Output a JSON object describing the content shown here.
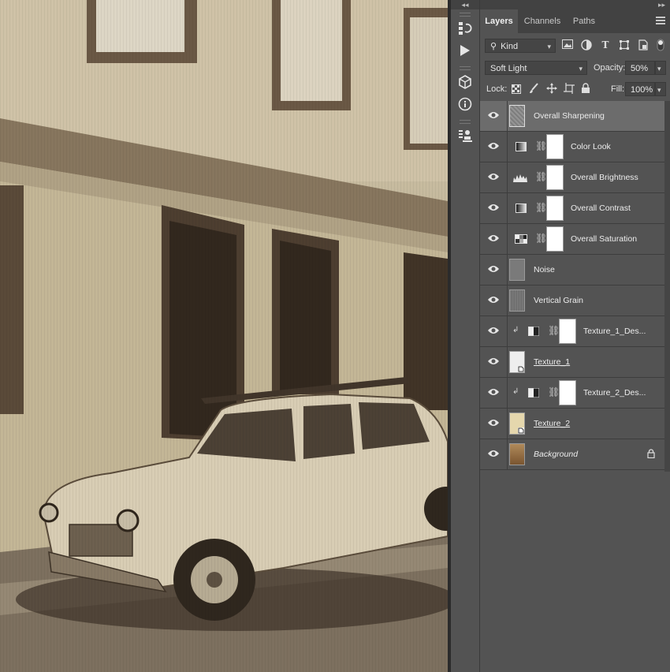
{
  "tabs": [
    {
      "label": "Layers",
      "active": true
    },
    {
      "label": "Channels",
      "active": false
    },
    {
      "label": "Paths",
      "active": false
    }
  ],
  "filter": {
    "kind_label": "Kind"
  },
  "blend": {
    "mode": "Soft Light",
    "opacity_label": "Opacity:",
    "opacity_value": "50%"
  },
  "lock": {
    "label": "Lock:",
    "fill_label": "Fill:",
    "fill_value": "100%"
  },
  "layers": [
    {
      "name": "Overall Sharpening",
      "selected": true
    },
    {
      "name": "Color Look"
    },
    {
      "name": "Overall Brightness"
    },
    {
      "name": "Overall Contrast"
    },
    {
      "name": "Overall Saturation"
    },
    {
      "name": "Noise"
    },
    {
      "name": "Vertical Grain"
    },
    {
      "name": "Texture_1_Des..."
    },
    {
      "name": "Texture_1"
    },
    {
      "name": "Texture_2_Des..."
    },
    {
      "name": "Texture_2"
    },
    {
      "name": "Background"
    }
  ],
  "colors": {
    "panel": "#535353",
    "header": "#424242",
    "selected_row": "#6c6c6c",
    "canvas_tone": "#cfc4a8"
  }
}
